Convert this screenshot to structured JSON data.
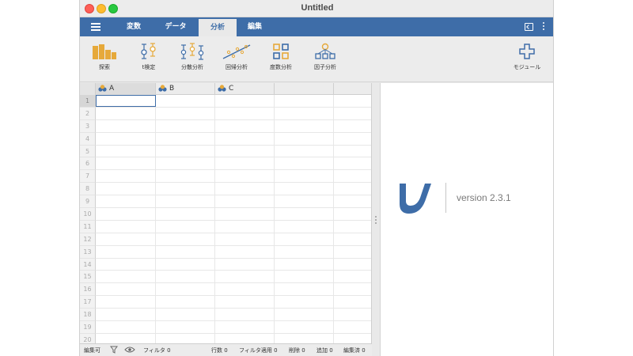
{
  "window": {
    "title": "Untitled"
  },
  "menubar": {
    "tabs": [
      {
        "label": "変数"
      },
      {
        "label": "データ"
      },
      {
        "label": "分析",
        "active": true
      },
      {
        "label": "編集"
      }
    ]
  },
  "ribbon": {
    "buttons": [
      {
        "label": "探索",
        "icon": "explore-bar-chart-icon"
      },
      {
        "label": "t検定",
        "icon": "ttest-icon"
      },
      {
        "label": "分散分析",
        "icon": "anova-icon"
      },
      {
        "label": "回帰分析",
        "icon": "regression-icon"
      },
      {
        "label": "度数分析",
        "icon": "frequencies-grid-icon"
      },
      {
        "label": "因子分析",
        "icon": "factor-tree-icon"
      }
    ],
    "modules": {
      "label": "モジュール",
      "icon": "plus-icon"
    }
  },
  "spreadsheet": {
    "columns": [
      "A",
      "B",
      "C",
      "",
      ""
    ],
    "rows": [
      "1",
      "2",
      "3",
      "4",
      "5",
      "6",
      "7",
      "8",
      "9",
      "10",
      "11",
      "12",
      "13",
      "14",
      "15",
      "16",
      "17",
      "18",
      "19",
      "20"
    ],
    "selected_row": "1",
    "selected_col": "A"
  },
  "results": {
    "logo": "jamovi-logo",
    "version": "version 2.3.1"
  },
  "statusbar": {
    "edit_mode": "編集可",
    "filters": "フィルタ 0",
    "row_count": "行数 0",
    "filtered": "フィルタ適用 0",
    "deleted": "削除 0",
    "added": "追加 0",
    "edited": "編集済 0"
  },
  "colors": {
    "accent": "#3e6da8",
    "icon_orange": "#e6a93a",
    "icon_blue": "#3e6da8"
  }
}
